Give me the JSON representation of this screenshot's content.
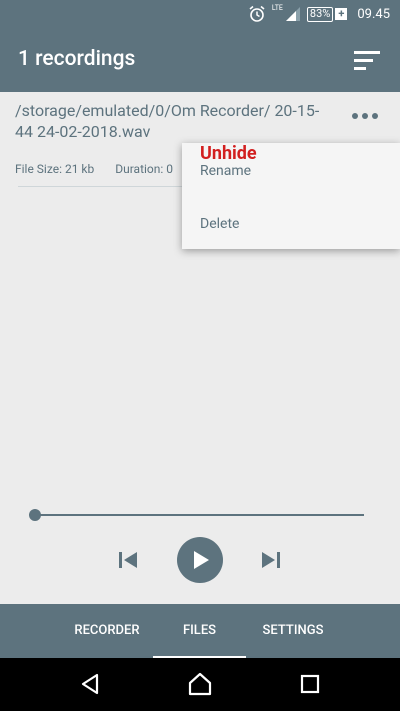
{
  "status_bar": {
    "network": "LTE",
    "battery": "83%",
    "battery_plus": "+",
    "time": "09.45"
  },
  "app_bar": {
    "title": "1 recordings"
  },
  "recording": {
    "path": "/storage/emulated/0/Om Recorder/ 20-15-44 24-02-2018.wav",
    "file_size": "File Size: 21 kb",
    "duration": "Duration: 0"
  },
  "popup_menu": {
    "unhide": "Unhide",
    "rename": "Rename",
    "delete": "Delete"
  },
  "player": {
    "progress": 0
  },
  "tabs": [
    {
      "label": "RECORDER"
    },
    {
      "label": "FILES"
    },
    {
      "label": "SETTINGS"
    }
  ],
  "colors": {
    "primary": "#5d737e",
    "background": "#ececec",
    "unhide_red": "#d21f1f"
  }
}
